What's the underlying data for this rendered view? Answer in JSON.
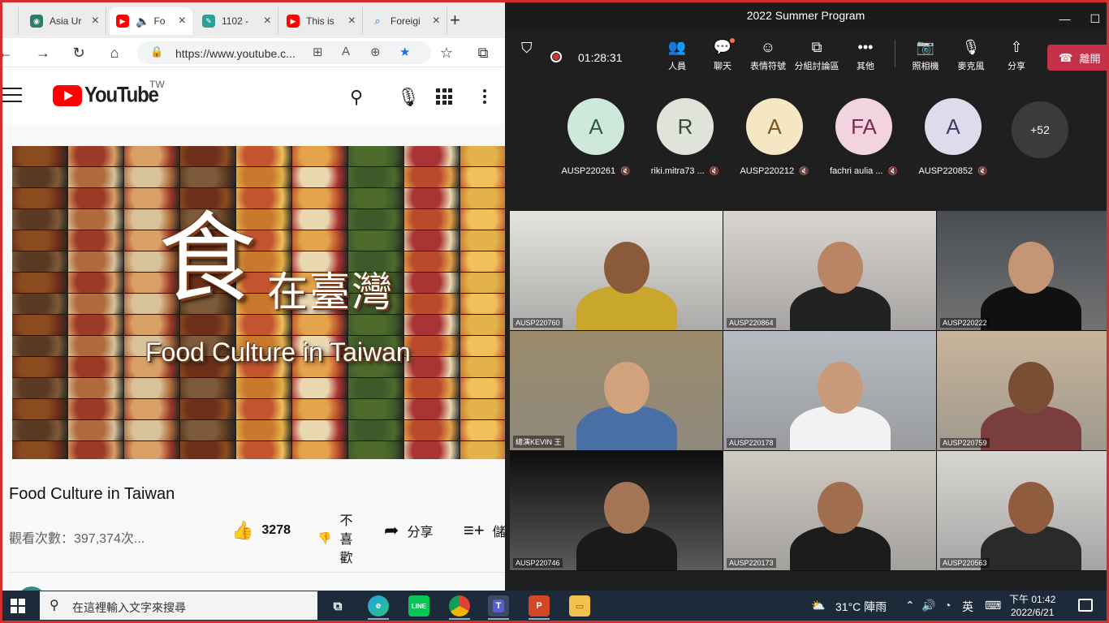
{
  "browser": {
    "tabs": [
      {
        "title": "Asia Ur",
        "color": "#2e7d6b"
      },
      {
        "title": "Fo",
        "color": "#ff0000"
      },
      {
        "title": "1102 -",
        "color": "#2aa198"
      },
      {
        "title": "This is",
        "color": "#ff0000"
      },
      {
        "title": "Foreigi",
        "color": "#1a73e8"
      }
    ],
    "url": "https://www.youtube.c..."
  },
  "youtube": {
    "logo_text": "YouTube",
    "region": "TW",
    "video": {
      "thumb_big": "食",
      "thumb_small": "在臺灣",
      "thumb_en": "Food Culture in Taiwan",
      "title": "Food Culture in Taiwan",
      "views": "觀看次數：397,374次...",
      "likes": "3278",
      "dislike_label": [
        "不",
        "喜",
        "歡"
      ],
      "share_label": "分享",
      "save_label": "儲"
    }
  },
  "teams": {
    "window_title": "2022 Summer Program",
    "timer": "01:28:31",
    "toolbar": [
      {
        "label": "人員",
        "icon": "people-icon"
      },
      {
        "label": "聊天",
        "icon": "chat-icon"
      },
      {
        "label": "表情符號",
        "icon": "emoji-icon"
      },
      {
        "label": "分組討論區",
        "icon": "breakout-icon"
      },
      {
        "label": "其他",
        "icon": "more-icon"
      },
      {
        "label": "照相機",
        "icon": "camera-off-icon"
      },
      {
        "label": "麥克風",
        "icon": "mic-off-icon"
      },
      {
        "label": "分享",
        "icon": "share-icon"
      }
    ],
    "leave_label": "離開",
    "avatars": [
      {
        "initials": "A",
        "name": "AUSP220261",
        "color": "#cfe8dc"
      },
      {
        "initials": "R",
        "name": "riki.mitra73 ...",
        "color": "#dfe3da"
      },
      {
        "initials": "A",
        "name": "AUSP220212",
        "color": "#f5e6c4"
      },
      {
        "initials": "FA",
        "name": "fachri aulia ...",
        "color": "#f2d4e0"
      },
      {
        "initials": "A",
        "name": "AUSP220852",
        "color": "#dedbec"
      }
    ],
    "more_count": "+52",
    "videos": [
      {
        "label": "AUSP220760",
        "bg": "#e6e4df",
        "shirt": "#c9a62c",
        "skin": "#8a5a3b"
      },
      {
        "label": "AUSP220864",
        "bg": "#d9d4cf",
        "shirt": "#222222",
        "skin": "#b98565"
      },
      {
        "label": "AUSP220222",
        "bg": "#4a4e52",
        "shirt": "#111111",
        "skin": "#c59676"
      },
      {
        "label": "總演KEVIN 王",
        "bg": "#9a8a6a",
        "shirt": "#4a6fa5",
        "skin": "#d2a27c"
      },
      {
        "label": "AUSP220178",
        "bg": "#b7bcc2",
        "shirt": "#f2f2f2",
        "skin": "#c99a7a"
      },
      {
        "label": "AUSP220759",
        "bg": "#c8b49a",
        "shirt": "#7a3e3e",
        "skin": "#7a4e34"
      },
      {
        "label": "AUSP220746",
        "bg": "#0e0e0e",
        "shirt": "#1a1a1a",
        "skin": "#a57556"
      },
      {
        "label": "AUSP220173",
        "bg": "#cfcac2",
        "shirt": "#1c1c1c",
        "skin": "#a06e4e"
      },
      {
        "label": "AUSP220563",
        "bg": "#d8d6d2",
        "shirt": "#2a2a2a",
        "skin": "#8f5c3f"
      }
    ]
  },
  "taskbar": {
    "search_placeholder": "在這裡輸入文字來搜尋",
    "weather": "31°C 陣雨",
    "ime": "英",
    "time": "下午 01:42",
    "date": "2022/6/21"
  }
}
